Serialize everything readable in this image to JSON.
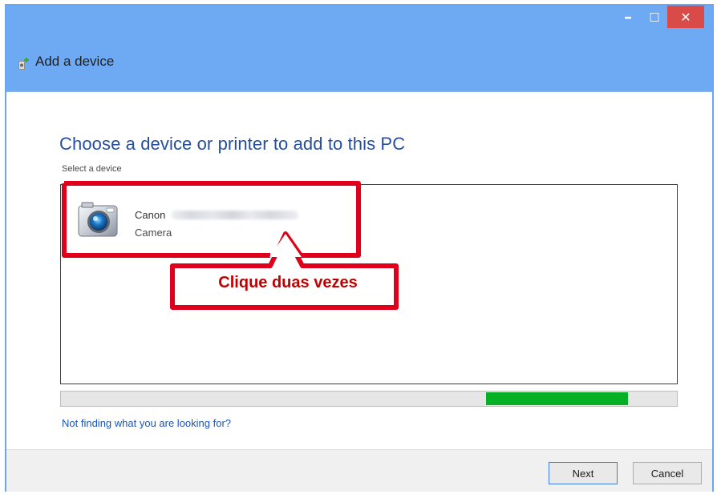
{
  "window": {
    "title": "Add a device",
    "controls": {
      "minimize": "–",
      "maximize": "□",
      "close": "✕"
    }
  },
  "wizard": {
    "heading": "Choose a device or printer to add to this PC",
    "subheading": "Select a device",
    "devices": [
      {
        "name": "Canon",
        "type": "Camera",
        "icon": "camera-icon"
      }
    ],
    "progress": {
      "start": 0.69,
      "end": 0.92
    },
    "help_link": "Not finding what you are looking for?"
  },
  "callout": {
    "text": "Clique duas vezes",
    "color": "#e0001b"
  },
  "buttons": {
    "next": "Next",
    "cancel": "Cancel"
  },
  "colors": {
    "title_bar": "#6eaaf4",
    "heading": "#264e9f",
    "progress": "#06b025",
    "close_button": "#d94b48"
  }
}
